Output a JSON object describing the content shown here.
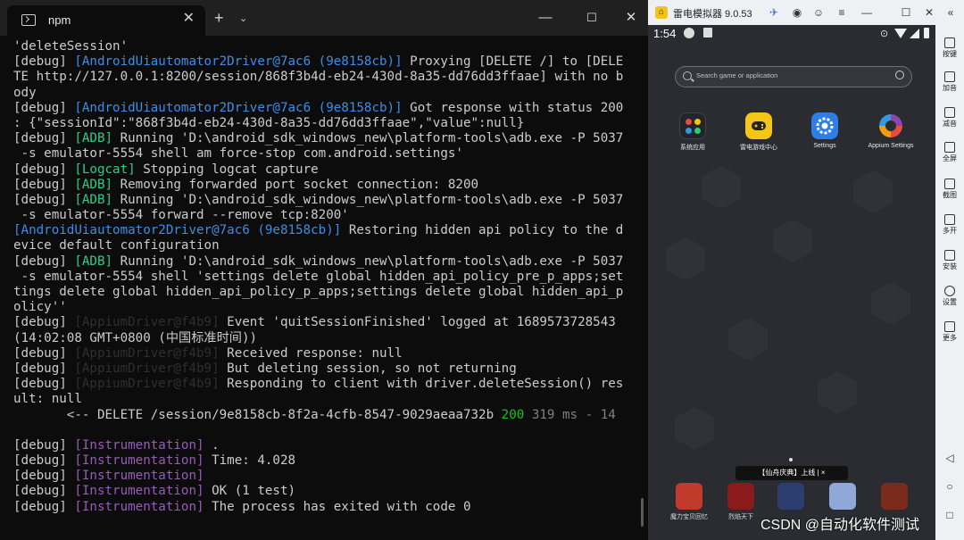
{
  "terminal": {
    "tab_title": "npm",
    "close_tab_glyph": "✕",
    "new_tab_glyph": "+",
    "dropdown_glyph": "⌄",
    "min_glyph": "—",
    "max_glyph": "☐",
    "close_glyph": "✕",
    "lines": [
      [
        {
          "t": "'deleteSession'",
          "c": ""
        }
      ],
      [
        {
          "t": "[debug] ",
          "c": ""
        },
        {
          "t": "[AndroidUiautomator2Driver@7ac6 (9e8158cb)]",
          "c": "cyan"
        },
        {
          "t": " Proxying [DELETE /] to [DELE",
          "c": ""
        }
      ],
      [
        {
          "t": "TE http://127.0.0.1:8200/session/868f3b4d-eb24-430d-8a35-dd76dd3ffaae] with no b",
          "c": ""
        }
      ],
      [
        {
          "t": "ody",
          "c": ""
        }
      ],
      [
        {
          "t": "[debug] ",
          "c": ""
        },
        {
          "t": "[AndroidUiautomator2Driver@7ac6 (9e8158cb)]",
          "c": "cyan"
        },
        {
          "t": " Got response with status 200",
          "c": ""
        }
      ],
      [
        {
          "t": ": {\"sessionId\":\"868f3b4d-eb24-430d-8a35-dd76dd3ffaae\",\"value\":null}",
          "c": ""
        }
      ],
      [
        {
          "t": "[debug] ",
          "c": ""
        },
        {
          "t": "[ADB]",
          "c": "green"
        },
        {
          "t": " Running 'D:\\android_sdk_windows_new\\platform-tools\\adb.exe -P 5037",
          "c": ""
        }
      ],
      [
        {
          "t": " -s emulator-5554 shell am force-stop com.android.settings'",
          "c": ""
        }
      ],
      [
        {
          "t": "[debug] ",
          "c": ""
        },
        {
          "t": "[Logcat]",
          "c": "green"
        },
        {
          "t": " Stopping logcat capture",
          "c": ""
        }
      ],
      [
        {
          "t": "[debug] ",
          "c": ""
        },
        {
          "t": "[ADB]",
          "c": "green"
        },
        {
          "t": " Removing forwarded port socket connection: 8200",
          "c": ""
        }
      ],
      [
        {
          "t": "[debug] ",
          "c": ""
        },
        {
          "t": "[ADB]",
          "c": "green"
        },
        {
          "t": " Running 'D:\\android_sdk_windows_new\\platform-tools\\adb.exe -P 5037",
          "c": ""
        }
      ],
      [
        {
          "t": " -s emulator-5554 forward --remove tcp:8200'",
          "c": ""
        }
      ],
      [
        {
          "t": "[AndroidUiautomator2Driver@7ac6 (9e8158cb)]",
          "c": "cyan"
        },
        {
          "t": " Restoring hidden api policy to the d",
          "c": ""
        }
      ],
      [
        {
          "t": "evice default configuration",
          "c": ""
        }
      ],
      [
        {
          "t": "[debug] ",
          "c": ""
        },
        {
          "t": "[ADB]",
          "c": "green"
        },
        {
          "t": " Running 'D:\\android_sdk_windows_new\\platform-tools\\adb.exe -P 5037",
          "c": ""
        }
      ],
      [
        {
          "t": " -s emulator-5554 shell 'settings delete global hidden_api_policy_pre_p_apps;set",
          "c": ""
        }
      ],
      [
        {
          "t": "tings delete global hidden_api_policy_p_apps;settings delete global hidden_api_p",
          "c": ""
        }
      ],
      [
        {
          "t": "olicy''",
          "c": ""
        }
      ],
      [
        {
          "t": "[debug] ",
          "c": ""
        },
        {
          "t": "[AppiumDriver@f4b9]",
          "c": "dim"
        },
        {
          "t": " Event 'quitSessionFinished' logged at 1689573728543",
          "c": ""
        }
      ],
      [
        {
          "t": "(14:02:08 GMT+0800 (中国标准时间))",
          "c": ""
        }
      ],
      [
        {
          "t": "[debug] ",
          "c": ""
        },
        {
          "t": "[AppiumDriver@f4b9]",
          "c": "dim"
        },
        {
          "t": " Received response: null",
          "c": ""
        }
      ],
      [
        {
          "t": "[debug] ",
          "c": ""
        },
        {
          "t": "[AppiumDriver@f4b9]",
          "c": "dim"
        },
        {
          "t": " But deleting session, so not returning",
          "c": ""
        }
      ],
      [
        {
          "t": "[debug] ",
          "c": ""
        },
        {
          "t": "[AppiumDriver@f4b9]",
          "c": "dim"
        },
        {
          "t": " Responding to client with driver.deleteSession() res",
          "c": ""
        }
      ],
      [
        {
          "t": "ult: null",
          "c": ""
        }
      ],
      [
        {
          "t": "       <-- DELETE /session/9e8158cb-8f2a-4cfb-8547-9029aeaa732b ",
          "c": ""
        },
        {
          "t": "200",
          "c": "stat"
        },
        {
          "t": " 319 ms - 14",
          "c": "gray"
        }
      ],
      [
        {
          "t": "",
          "c": ""
        }
      ],
      [
        {
          "t": "[debug] ",
          "c": ""
        },
        {
          "t": "[Instrumentation]",
          "c": "purple"
        },
        {
          "t": " .",
          "c": ""
        }
      ],
      [
        {
          "t": "[debug] ",
          "c": ""
        },
        {
          "t": "[Instrumentation]",
          "c": "purple"
        },
        {
          "t": " Time: 4.028",
          "c": ""
        }
      ],
      [
        {
          "t": "[debug] ",
          "c": ""
        },
        {
          "t": "[Instrumentation]",
          "c": "purple"
        }
      ],
      [
        {
          "t": "[debug] ",
          "c": ""
        },
        {
          "t": "[Instrumentation]",
          "c": "purple"
        },
        {
          "t": " OK (1 test)",
          "c": ""
        }
      ],
      [
        {
          "t": "[debug] ",
          "c": ""
        },
        {
          "t": "[Instrumentation]",
          "c": "purple"
        },
        {
          "t": " The process has exited with code 0",
          "c": ""
        }
      ]
    ],
    "colors": {
      "cyan": "#3b8eea",
      "green": "#23d18b",
      "purple": "#9a5ab8",
      "background": "#0c0c0c",
      "text": "#cccccc"
    }
  },
  "emulator": {
    "title": "雷电模拟器 9.0.53",
    "logo_glyph": "⌂",
    "titlebar_icons": [
      "rocket-icon",
      "gamepad-icon",
      "user-icon",
      "menu-icon",
      "minimize-icon",
      "restore-icon",
      "close-icon",
      "collapse-icon"
    ],
    "titlebar_glyphs": [
      "✈",
      "◉",
      "☺",
      "≡",
      "—",
      "☐",
      "✕",
      "«"
    ],
    "time": "1:54",
    "status_loc_glyph": "⊙",
    "search_placeholder": "Search game or application",
    "apps": [
      {
        "label": "系统应用",
        "icon": "sysapps-icon"
      },
      {
        "label": "雷电游戏中心",
        "icon": "gamepad-icon"
      },
      {
        "label": "Settings",
        "icon": "settings-gear-icon"
      },
      {
        "label": "Appium Settings",
        "icon": "appium-icon"
      }
    ],
    "promo_banner": "【仙舟庆典】上线  |  ×",
    "games": [
      {
        "label": "魔力宝贝回忆",
        "color": "#c0392b"
      },
      {
        "label": "烈焰天下",
        "color": "#8b1a1a"
      },
      {
        "label": "",
        "color": "#2c3e70"
      },
      {
        "label": "",
        "color": "#8fa8d8"
      },
      {
        "label": "",
        "color": "#7a2b1b"
      }
    ],
    "sidebar": [
      {
        "label": "按键",
        "icon": "keyboard-icon"
      },
      {
        "label": "加音",
        "icon": "volume-up-icon"
      },
      {
        "label": "减音",
        "icon": "volume-down-icon"
      },
      {
        "label": "全屏",
        "icon": "fullscreen-icon"
      },
      {
        "label": "截图",
        "icon": "scissors-icon"
      },
      {
        "label": "多开",
        "icon": "multi-instance-icon"
      },
      {
        "label": "安装",
        "icon": "apk-install-icon"
      },
      {
        "label": "设置",
        "icon": "settings-icon"
      },
      {
        "label": "更多",
        "icon": "more-icon"
      }
    ],
    "nav_glyphs": [
      "◁",
      "○",
      "□"
    ]
  },
  "watermark": "CSDN @自动化软件测试"
}
